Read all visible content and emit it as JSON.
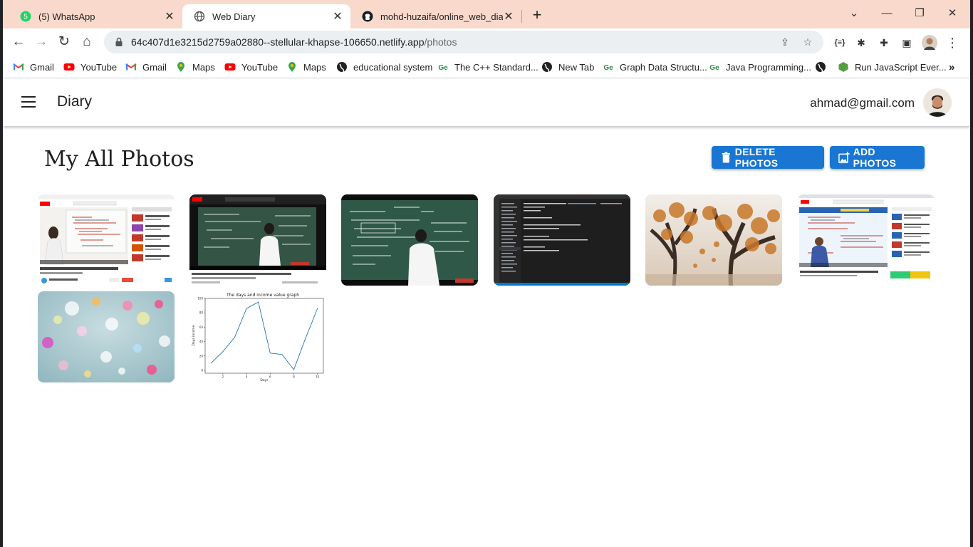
{
  "browser": {
    "tabs": [
      {
        "title": "(5) WhatsApp",
        "badge": "5"
      },
      {
        "title": "Web Diary"
      },
      {
        "title": "mohd-huzaifa/online_web_diary"
      }
    ],
    "url_host": "64c407d1e3215d2759a02880--stellular-khapse-106650.netlify.app",
    "url_path": "/photos",
    "bookmarks": [
      {
        "label": "Gmail",
        "icon": "gmail-icon"
      },
      {
        "label": "YouTube",
        "icon": "youtube-icon"
      },
      {
        "label": "Gmail",
        "icon": "gmail-icon"
      },
      {
        "label": "Maps",
        "icon": "maps-icon"
      },
      {
        "label": "YouTube",
        "icon": "youtube-icon"
      },
      {
        "label": "Maps",
        "icon": "maps-icon"
      },
      {
        "label": "educational system",
        "icon": "globe-icon"
      },
      {
        "label": "The C++ Standard...",
        "icon": "gfg-icon"
      },
      {
        "label": "New Tab",
        "icon": "globe-icon"
      },
      {
        "label": "Graph Data Structu...",
        "icon": "gfg-icon"
      },
      {
        "label": "Java Programming...",
        "icon": "gfg-icon"
      },
      {
        "label": "",
        "icon": "globe-icon"
      },
      {
        "label": "Run JavaScript Ever...",
        "icon": "nodejs-icon"
      }
    ],
    "more_bookmarks": "»"
  },
  "app": {
    "brand": "Diary",
    "user_email": "ahmad@gmail.com",
    "page_title": "My All Photos",
    "delete_label": "DELETE PHOTOS",
    "add_label": "ADD PHOTOS",
    "accent_color": "#1976d2"
  },
  "photos": [
    {
      "desc": "video-lecture-screenshot-whiteboard"
    },
    {
      "desc": "video-lecture-screenshot-chalkboard"
    },
    {
      "desc": "chalkboard-lecture"
    },
    {
      "desc": "code-editor-screenshot"
    },
    {
      "desc": "autumn-trees"
    },
    {
      "desc": "video-lecture-screenshot-mathematics"
    },
    {
      "desc": "bokeh-lights"
    },
    {
      "desc": "days-income-graph"
    }
  ],
  "chart_data": {
    "type": "line",
    "title": "The days and income value graph",
    "xlabel": "Days",
    "ylabel": "Days income",
    "x": [
      1,
      2,
      3,
      4,
      5,
      6,
      7,
      8,
      9,
      10
    ],
    "values": [
      10,
      26,
      46,
      86,
      95,
      24,
      22,
      1,
      45,
      86
    ],
    "xticks": [
      "2",
      "4",
      "6",
      "8",
      "10"
    ],
    "yticks": [
      "0",
      "20",
      "40",
      "60",
      "80",
      "100"
    ],
    "xlim": [
      0.5,
      10.5
    ],
    "ylim": [
      -4,
      100
    ],
    "line_color": "#1f77b4"
  }
}
